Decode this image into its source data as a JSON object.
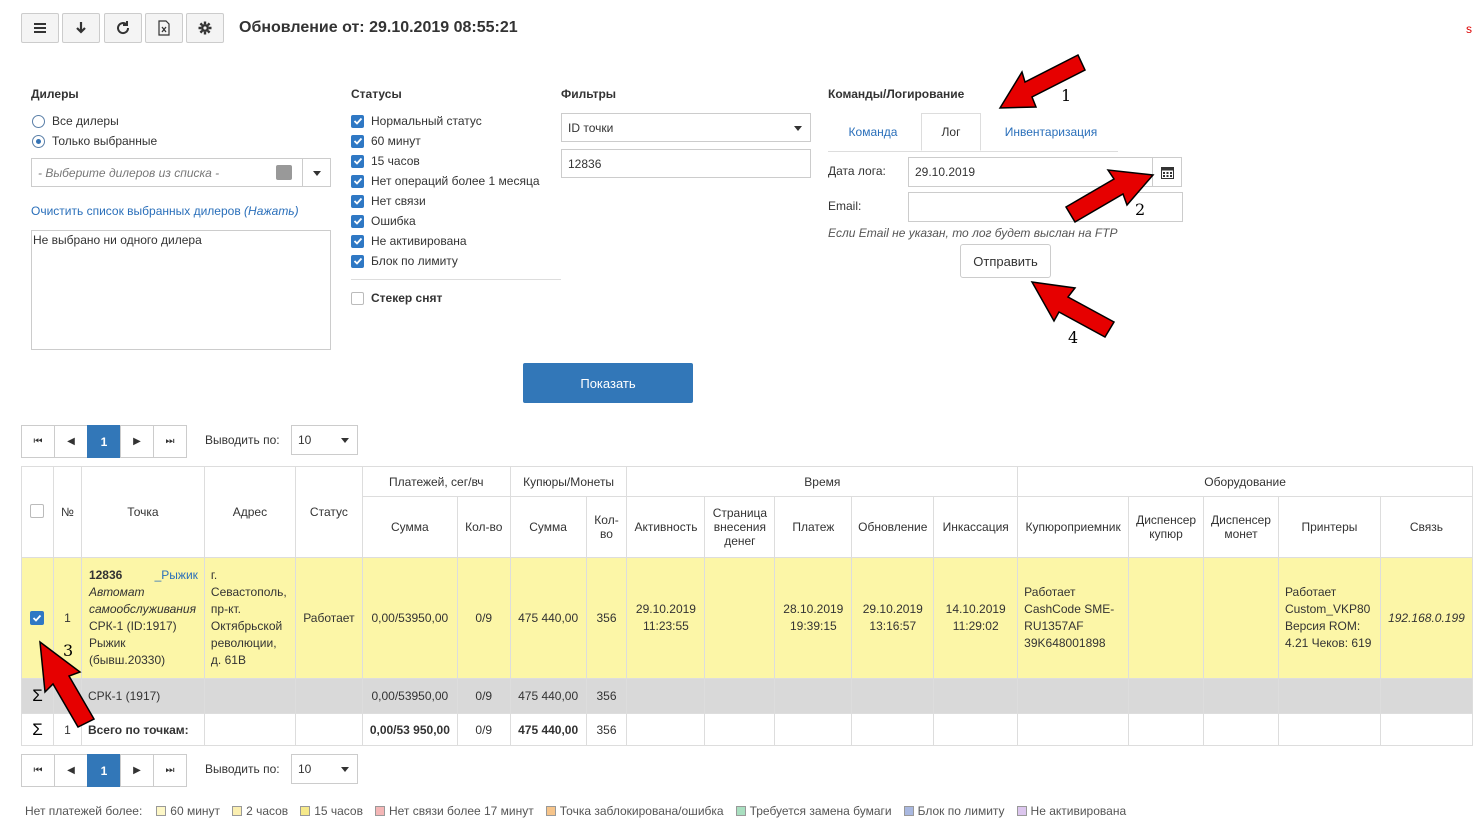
{
  "toolbar": {
    "title": "Обновление от: 29.10.2019 08:55:21",
    "corner_mark": "s"
  },
  "dealers": {
    "heading": "Дилеры",
    "radio_all": "Все дилеры",
    "radio_selected": "Только выбранные",
    "select_placeholder": "- Выберите дилеров из списка -",
    "clear_link": "Очистить список выбранных дилеров",
    "clear_link_hint": "(Нажать)",
    "selected_box": "Не выбрано ни одного дилера"
  },
  "statuses": {
    "heading": "Статусы",
    "items": [
      {
        "label": "Нормальный статус",
        "checked": true
      },
      {
        "label": "60 минут",
        "checked": true
      },
      {
        "label": "15 часов",
        "checked": true
      },
      {
        "label": "Нет операций более 1 месяца",
        "checked": true
      },
      {
        "label": "Нет связи",
        "checked": true
      },
      {
        "label": "Ошибка",
        "checked": true
      },
      {
        "label": "Не активирована",
        "checked": true
      },
      {
        "label": "Блок по лимиту",
        "checked": true
      }
    ],
    "sticker_label": "Стекер снят"
  },
  "filters": {
    "heading": "Фильтры",
    "field_select": "ID точки",
    "value": "12836"
  },
  "commands": {
    "heading": "Команды/Логирование",
    "tabs": [
      "Команда",
      "Лог",
      "Инвентаризация"
    ],
    "date_label": "Дата лога:",
    "date_value": "29.10.2019",
    "email_label": "Email:",
    "email_value": "",
    "hint": "Если Email не указан, то лог будет выслан на FTP",
    "send_button": "Отправить"
  },
  "show_button": "Показать",
  "pager": {
    "current_page": "1",
    "per_page_label": "Выводить по:",
    "per_page_value": "10"
  },
  "table": {
    "group_headers": {
      "payments": "Платежей, сег/вч",
      "bills": "Купюры/Монеты",
      "time": "Время",
      "equipment": "Оборудование"
    },
    "headers": {
      "num": "№",
      "point": "Точка",
      "address": "Адрес",
      "status": "Статус",
      "pay_sum": "Сумма",
      "pay_count": "Кол-во",
      "bill_sum": "Сумма",
      "bill_count": "Кол-во",
      "activity": "Активность",
      "deposit_page": "Страница внесения денег",
      "payment": "Платеж",
      "update": "Обновление",
      "collection": "Инкассация",
      "bill_acceptor": "Купюроприемник",
      "bill_dispenser": "Диспенсер купюр",
      "coin_dispenser": "Диспенсер монет",
      "printers": "Принтеры",
      "link": "Связь"
    },
    "row": {
      "num": "1",
      "point_id": "12836",
      "point_owner": "_Рыжик",
      "point_type": "Автомат самообслуживания",
      "point_name": "СРК-1 (ID:1917) Рыжик (бывш.20330)",
      "address": "г. Севастополь, пр-кт. Октябрьской революции, д. 61В",
      "status": "Работает",
      "pay_sum": "0,00/53950,00",
      "pay_count": "0/9",
      "bill_sum": "475 440,00",
      "bill_count": "356",
      "activity": "29.10.2019 11:23:55",
      "deposit_page": "",
      "payment": "28.10.2019 19:39:15",
      "update": "29.10.2019 13:16:57",
      "collection": "14.10.2019 11:29:02",
      "bill_acceptor": "Работает CashCode SME-RU1357AF 39K648001898",
      "printers": "Работает Custom_VKP80 Версия ROM: 4.21 Чеков: 619",
      "link": "192.168.0.199"
    },
    "subtotal": {
      "sigma": "Σ",
      "label": "СРК-1 (1917)",
      "pay_sum": "0,00/53950,00",
      "pay_count": "0/9",
      "bill_sum": "475 440,00",
      "bill_count": "356"
    },
    "total": {
      "sigma": "Σ",
      "num": "1",
      "label": "Всего по точкам:",
      "pay_sum": "0,00/53 950,00",
      "pay_count": "0/9",
      "bill_sum": "475 440,00",
      "bill_count": "356"
    }
  },
  "legend": {
    "label": "Нет платежей более:",
    "items": [
      {
        "label": "60 минут",
        "color": "#fdf7c7"
      },
      {
        "label": "2 часов",
        "color": "#fbefb1"
      },
      {
        "label": "15 часов",
        "color": "#f6e98a"
      },
      {
        "label": "Нет связи более 17 минут",
        "color": "#f4b6b6"
      },
      {
        "label": "Точка заблокирована/ошибка",
        "color": "#f6c48a"
      },
      {
        "label": "Требуется замена бумаги",
        "color": "#a9dfc0"
      },
      {
        "label": "Блок по лимиту",
        "color": "#a9b8e0"
      },
      {
        "label": "Не активирована",
        "color": "#dcc6ee"
      }
    ]
  },
  "annotations": [
    "1",
    "2",
    "3",
    "4"
  ],
  "colors": {
    "accent": "#3277b8",
    "highlight_row": "#fcf6a7",
    "subtotal_row": "#d9d9d9",
    "arrow": "#e60000"
  }
}
